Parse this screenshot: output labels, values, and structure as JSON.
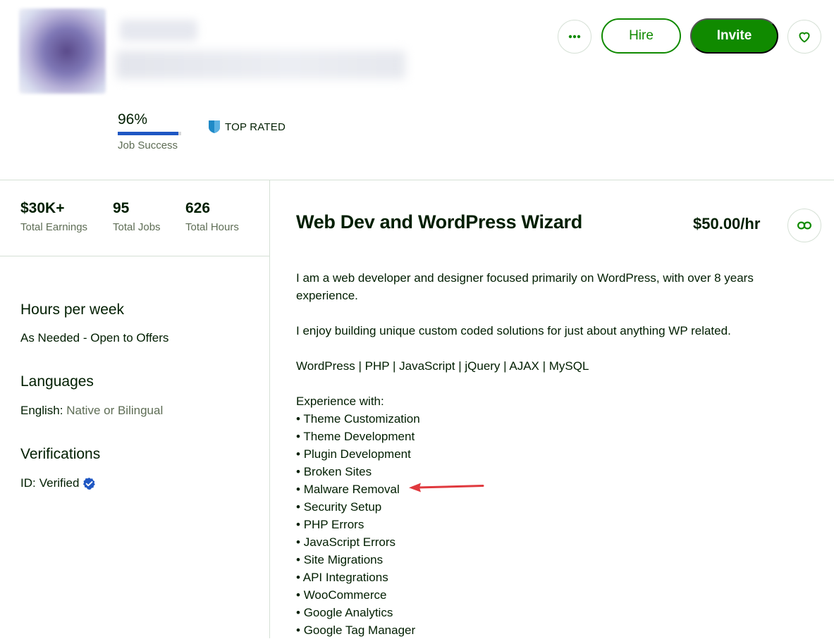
{
  "header": {
    "buttons": {
      "hire": "Hire",
      "invite": "Invite"
    },
    "job_success": {
      "value": "96%",
      "label": "Job Success",
      "fraction": 0.96
    },
    "badge": "TOP RATED"
  },
  "stats": [
    {
      "value": "$30K+",
      "label": "Total Earnings"
    },
    {
      "value": "95",
      "label": "Total Jobs"
    },
    {
      "value": "626",
      "label": "Total Hours"
    }
  ],
  "sidebar": {
    "hours": {
      "heading": "Hours per week",
      "value": "As Needed - Open to Offers"
    },
    "languages": {
      "heading": "Languages",
      "name": "English:",
      "level": "Native or Bilingual"
    },
    "verifications": {
      "heading": "Verifications",
      "label": "ID:",
      "value": "Verified"
    }
  },
  "profile": {
    "title": "Web Dev and WordPress Wizard",
    "rate": "$50.00/hr",
    "description": {
      "intro": "I am a web developer and designer focused primarily on WordPress, with over 8 years experience.",
      "line2": "I enjoy building unique custom coded solutions for just about anything WP related.",
      "skills_line": "WordPress | PHP | JavaScript | jQuery | AJAX | MySQL",
      "experience_heading": "Experience with:",
      "experience": [
        "Theme Customization",
        "Theme Development",
        "Plugin Development",
        "Broken Sites",
        "Malware Removal",
        "Security Setup",
        "PHP Errors",
        "JavaScript Errors",
        "Site Migrations",
        "API Integrations",
        "WooCommerce",
        "Google Analytics",
        "Google Tag Manager"
      ]
    }
  },
  "colors": {
    "brand_green": "#108a00",
    "job_success_bar": "#1f57c3",
    "annotation_arrow": "#e0393e"
  }
}
